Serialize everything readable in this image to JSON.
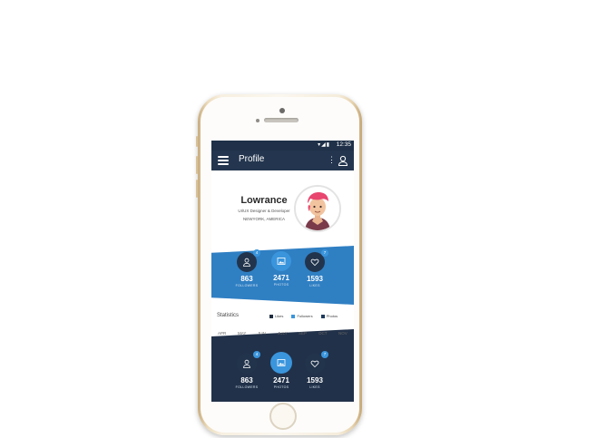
{
  "status": {
    "time": "12:35",
    "icons": "▾◢▮"
  },
  "appbar": {
    "title": "Profile",
    "menu_glyph": "⋮"
  },
  "profile": {
    "name": "Lowrance",
    "role": "UI/UX Designer & Developer",
    "location": "NEWYORK, AMERICA"
  },
  "stats_top": [
    {
      "count": "863",
      "label": "FOLLOWERS",
      "badge": "4",
      "icon": "user-icon"
    },
    {
      "count": "2471",
      "label": "PHOTOS",
      "badge": "",
      "icon": "photo-icon"
    },
    {
      "count": "1593",
      "label": "LIKES",
      "badge": "7",
      "icon": "heart-icon"
    }
  ],
  "chart": {
    "title": "Statistics",
    "legend": [
      {
        "name": "Likes",
        "color": "#1f2d40"
      },
      {
        "name": "Followers",
        "color": "#3a95dc"
      },
      {
        "name": "Photos",
        "color": "#1e3a5c"
      }
    ],
    "months": [
      "APR",
      "MAY",
      "JUN",
      "JULY",
      "SEP",
      "OCT",
      "NOV"
    ]
  },
  "stats_bottom": [
    {
      "count": "863",
      "label": "FOLLOWERS",
      "badge": "4",
      "icon": "user-icon"
    },
    {
      "count": "2471",
      "label": "PHOTOS",
      "badge": "",
      "icon": "photo-icon"
    },
    {
      "count": "1593",
      "label": "LIKES",
      "badge": "7",
      "icon": "heart-icon"
    }
  ],
  "colors": {
    "appbar": "#24364f",
    "accent": "#3a95dc",
    "band_blue": "#2f7fc3",
    "band_dark": "#213149"
  }
}
